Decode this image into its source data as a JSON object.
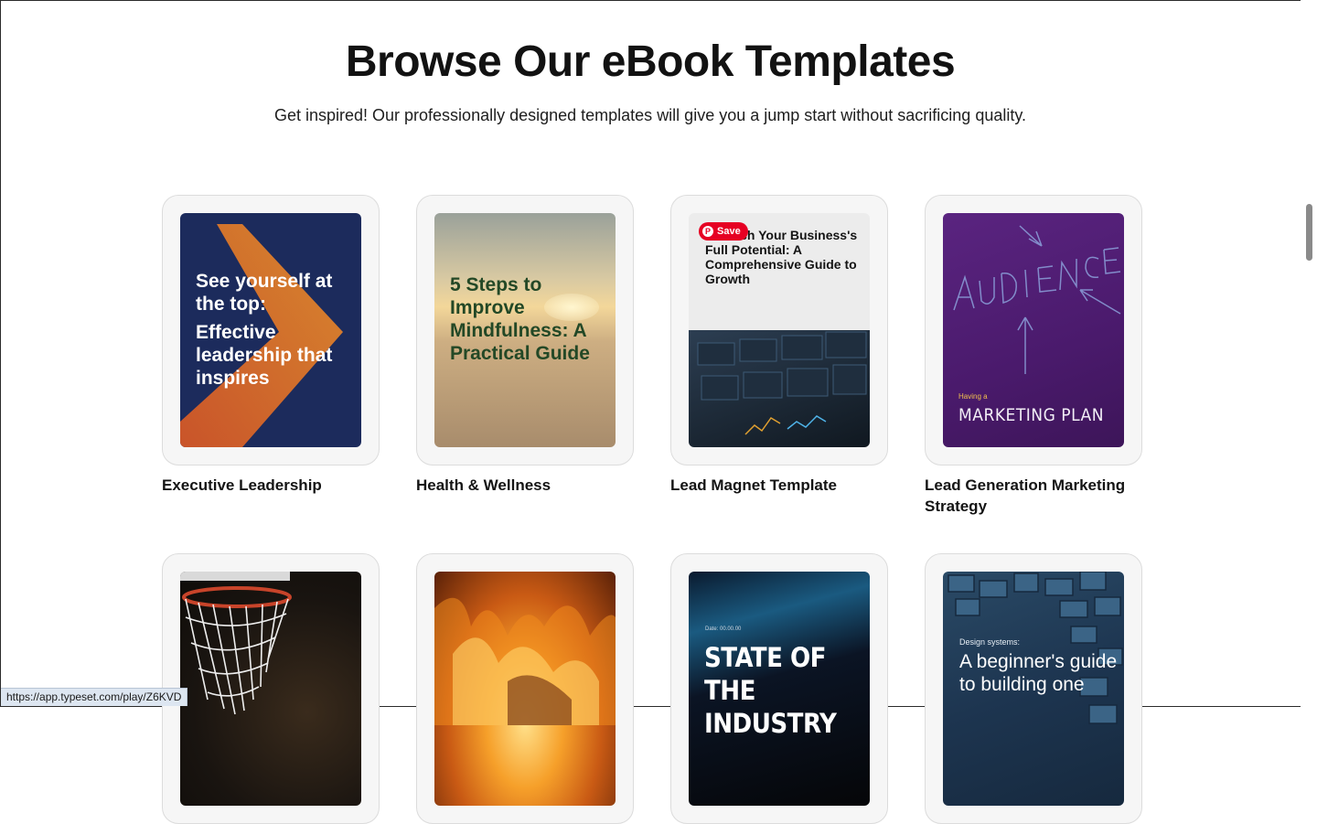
{
  "header": {
    "title": "Browse Our eBook Templates",
    "subtitle": "Get inspired! Our professionally designed templates will give you a jump start without sacrificing quality."
  },
  "templates": [
    {
      "title": "Executive Leadership",
      "cover_lines": [
        "See yourself at the top:",
        "Effective leadership that inspires"
      ]
    },
    {
      "title": "Health & Wellness",
      "cover_lines": [
        "5 Steps to Improve Mindfulness: A Practical Guide"
      ]
    },
    {
      "title": "Lead Magnet Template",
      "cover_lines": [
        "Unleash Your Business's Full Potential: A Comprehensive Guide to Growth"
      ]
    },
    {
      "title": "Lead Generation Marketing Strategy",
      "cover_lines": [
        "Having a",
        "MARKETING PLAN"
      ]
    },
    {
      "title": "",
      "cover_lines": []
    },
    {
      "title": "",
      "cover_lines": []
    },
    {
      "title": "",
      "cover_lines": [
        "Date: 00.00.00",
        "STATE OF THE INDUSTRY"
      ]
    },
    {
      "title": "",
      "cover_lines": [
        "Design systems:",
        "A beginner's guide to building one"
      ]
    }
  ],
  "pinterest": {
    "save_label": "Save"
  },
  "status": {
    "url": "https://app.typeset.com/play/Z6KVD"
  },
  "colors": {
    "pinterest_red": "#e60023",
    "status_bg": "#dde6f1"
  }
}
